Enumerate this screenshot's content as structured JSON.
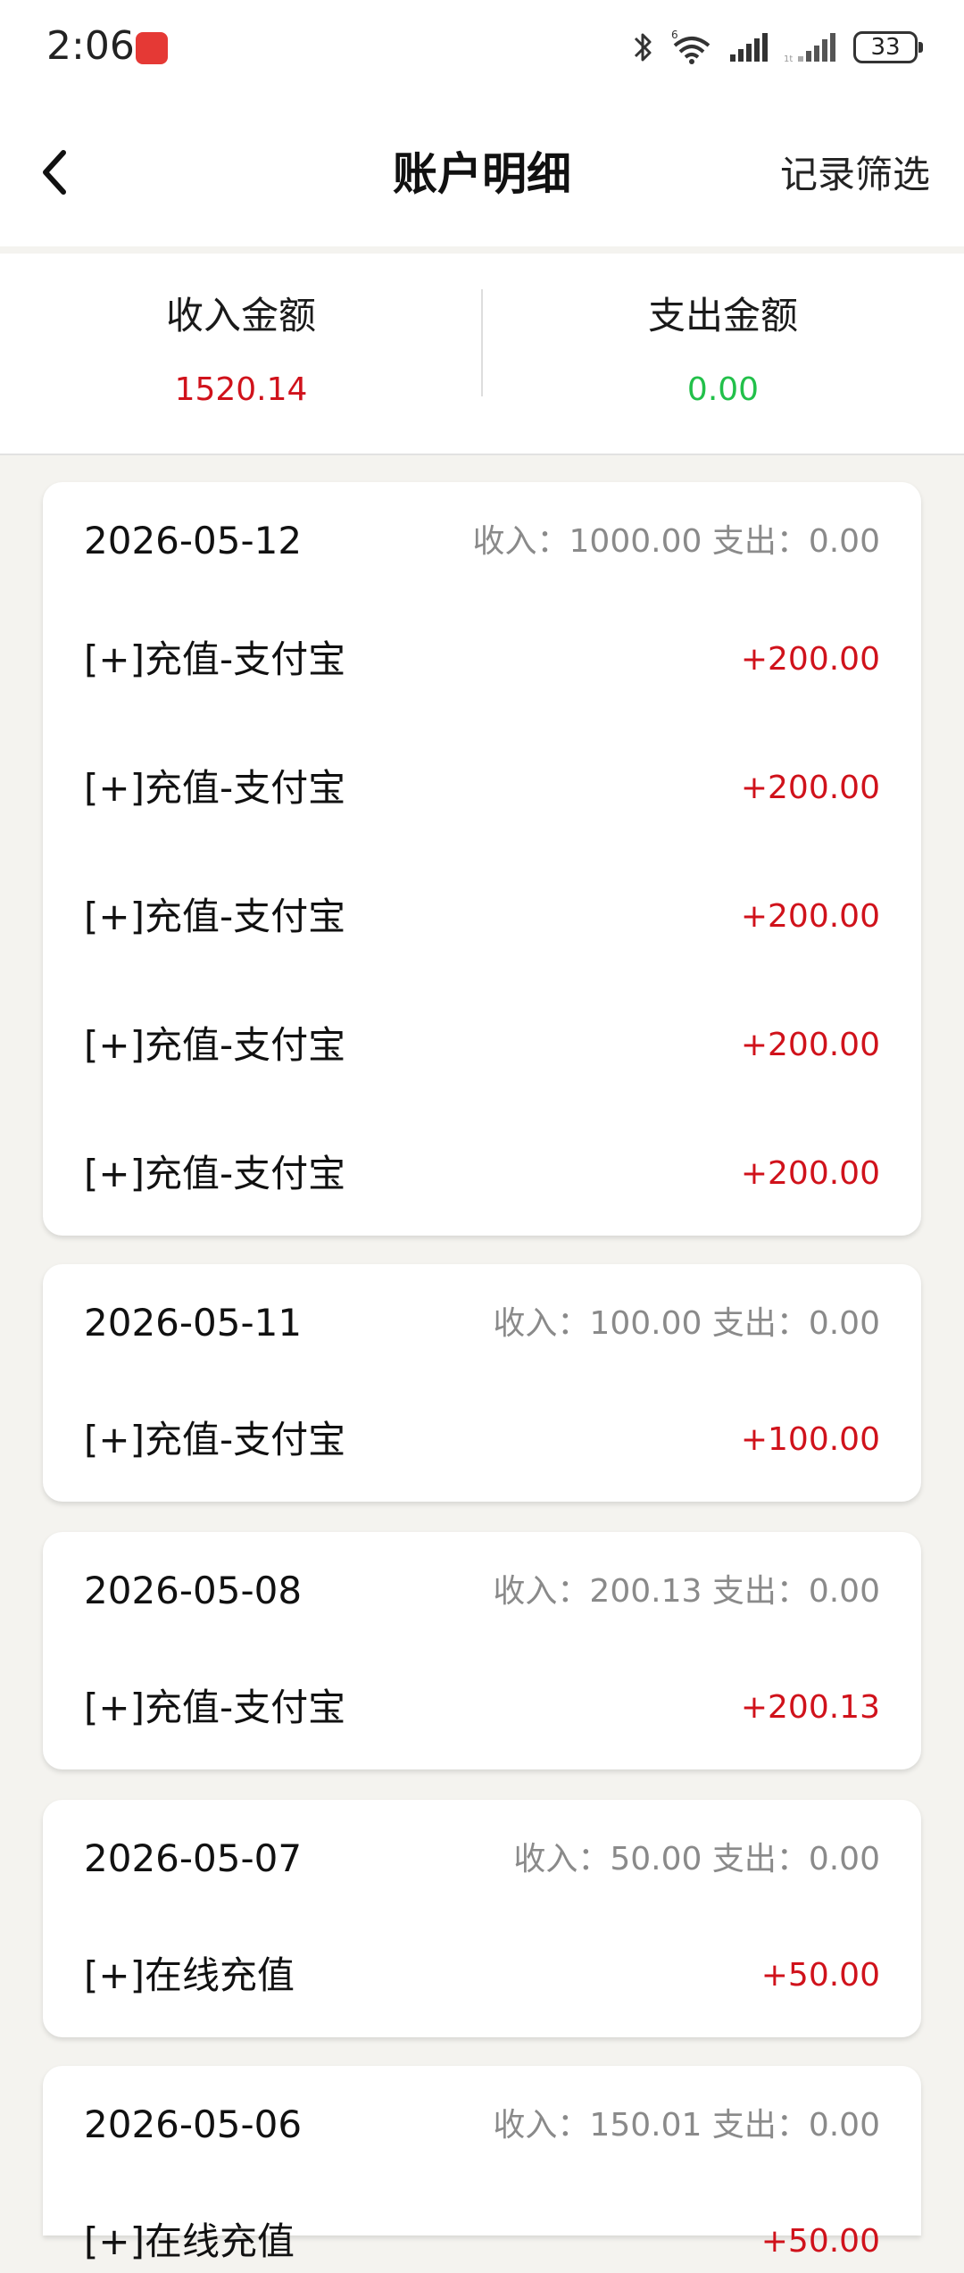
{
  "status_bar": {
    "time": "2:06",
    "battery": "33",
    "icons": [
      "app-notification-icon",
      "bluetooth-icon",
      "wifi-6-icon",
      "signal-icon",
      "signal-icon-2",
      "battery-icon"
    ]
  },
  "header": {
    "title": "账户明细",
    "filter_label": "记录筛选",
    "back_icon": "chevron-left-icon"
  },
  "summary": {
    "income_label": "收入金额",
    "income_value": "1520.14",
    "expense_label": "支出金额",
    "expense_value": "0.00"
  },
  "colors": {
    "income": "#d0121b",
    "expense": "#22c04a",
    "amount_positive": "#d0121b",
    "muted": "#8a8a8a",
    "page_bg": "#f4f3ef"
  },
  "groups": [
    {
      "date": "2026-05-12",
      "summary": "收入：1000.00 支出：0.00",
      "items": [
        {
          "label": "[+]充值-支付宝",
          "amount": "+200.00"
        },
        {
          "label": "[+]充值-支付宝",
          "amount": "+200.00"
        },
        {
          "label": "[+]充值-支付宝",
          "amount": "+200.00"
        },
        {
          "label": "[+]充值-支付宝",
          "amount": "+200.00"
        },
        {
          "label": "[+]充值-支付宝",
          "amount": "+200.00"
        }
      ]
    },
    {
      "date": "2026-05-11",
      "summary": "收入：100.00 支出：0.00",
      "items": [
        {
          "label": "[+]充值-支付宝",
          "amount": "+100.00"
        }
      ]
    },
    {
      "date": "2026-05-08",
      "summary": "收入：200.13 支出：0.00",
      "items": [
        {
          "label": "[+]充值-支付宝",
          "amount": "+200.13"
        }
      ]
    },
    {
      "date": "2026-05-07",
      "summary": "收入：50.00 支出：0.00",
      "items": [
        {
          "label": "[+]在线充值",
          "amount": "+50.00"
        }
      ]
    },
    {
      "date": "2026-05-06",
      "summary": "收入：150.01 支出：0.00",
      "items": [
        {
          "label": "[+]在线充值",
          "amount": "+50.00"
        }
      ]
    }
  ]
}
